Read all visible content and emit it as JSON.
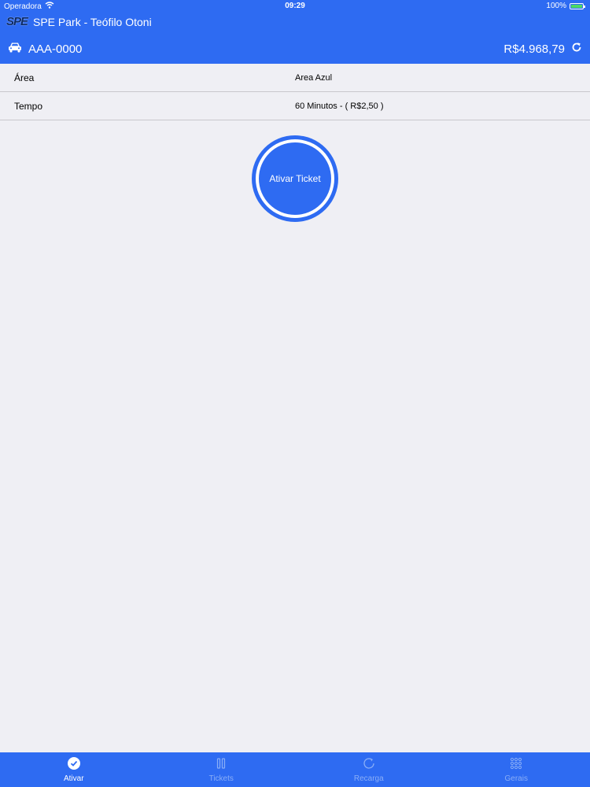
{
  "status_bar": {
    "carrier": "Operadora",
    "time": "09:29",
    "battery": "100%"
  },
  "header": {
    "logo_text": "SPE",
    "title": "SPE Park - Teófilo Otoni",
    "plate": "AAA-0000",
    "balance": "R$4.968,79"
  },
  "form": {
    "rows": [
      {
        "label": "Área",
        "value": "Area Azul"
      },
      {
        "label": "Tempo",
        "value": "60 Minutos - ( R$2,50 )"
      }
    ]
  },
  "activate_button": {
    "label": "Ativar Ticket"
  },
  "tabs": [
    {
      "label": "Ativar",
      "icon": "check-circle-icon",
      "active": true
    },
    {
      "label": "Tickets",
      "icon": "tickets-icon",
      "active": false
    },
    {
      "label": "Recarga",
      "icon": "refresh-circle-icon",
      "active": false
    },
    {
      "label": "Gerais",
      "icon": "grid-icon",
      "active": false
    }
  ],
  "colors": {
    "primary": "#2e6bf2",
    "background": "#efeff4",
    "inactive_tab": "#8aaef7"
  }
}
